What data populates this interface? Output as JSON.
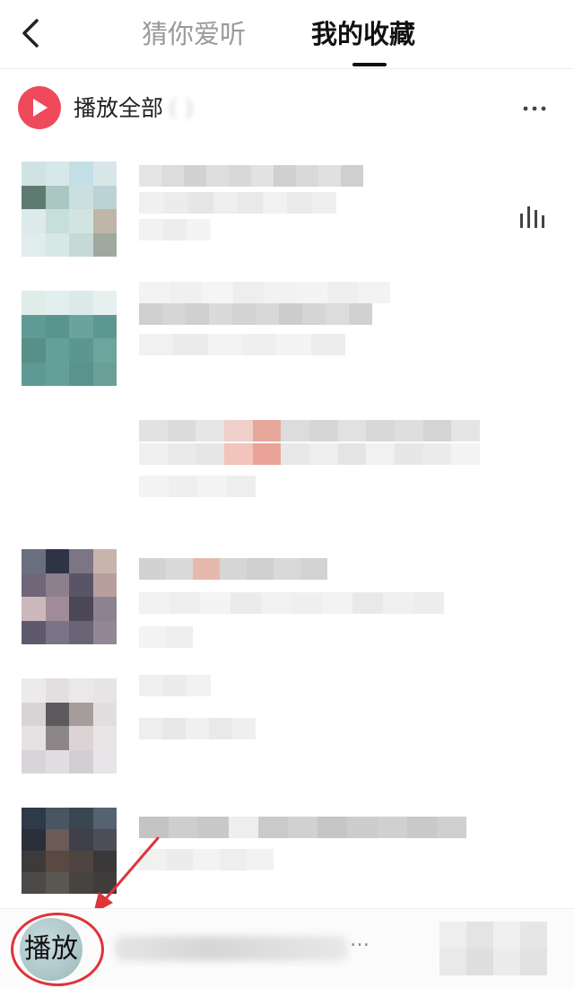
{
  "header": {
    "back_icon": "chevron-left-icon",
    "tabs": [
      {
        "label": "猜你爱听",
        "active": false
      },
      {
        "label": "我的收藏",
        "active": true
      }
    ]
  },
  "play_all": {
    "label": "播放全部",
    "icon": "play-icon",
    "accent_color": "#ee4a5c",
    "more_icon": "more-horizontal-icon"
  },
  "now_playing_indicator": "equalizer-icon",
  "bottom_player": {
    "label": "播放",
    "ellipsis": "…",
    "annotation_color": "#e0333a"
  },
  "colors": {
    "accent": "#ee4a5c",
    "annotation": "#e0333a",
    "tab_inactive": "#9a9a9a",
    "tab_active": "#111111"
  }
}
